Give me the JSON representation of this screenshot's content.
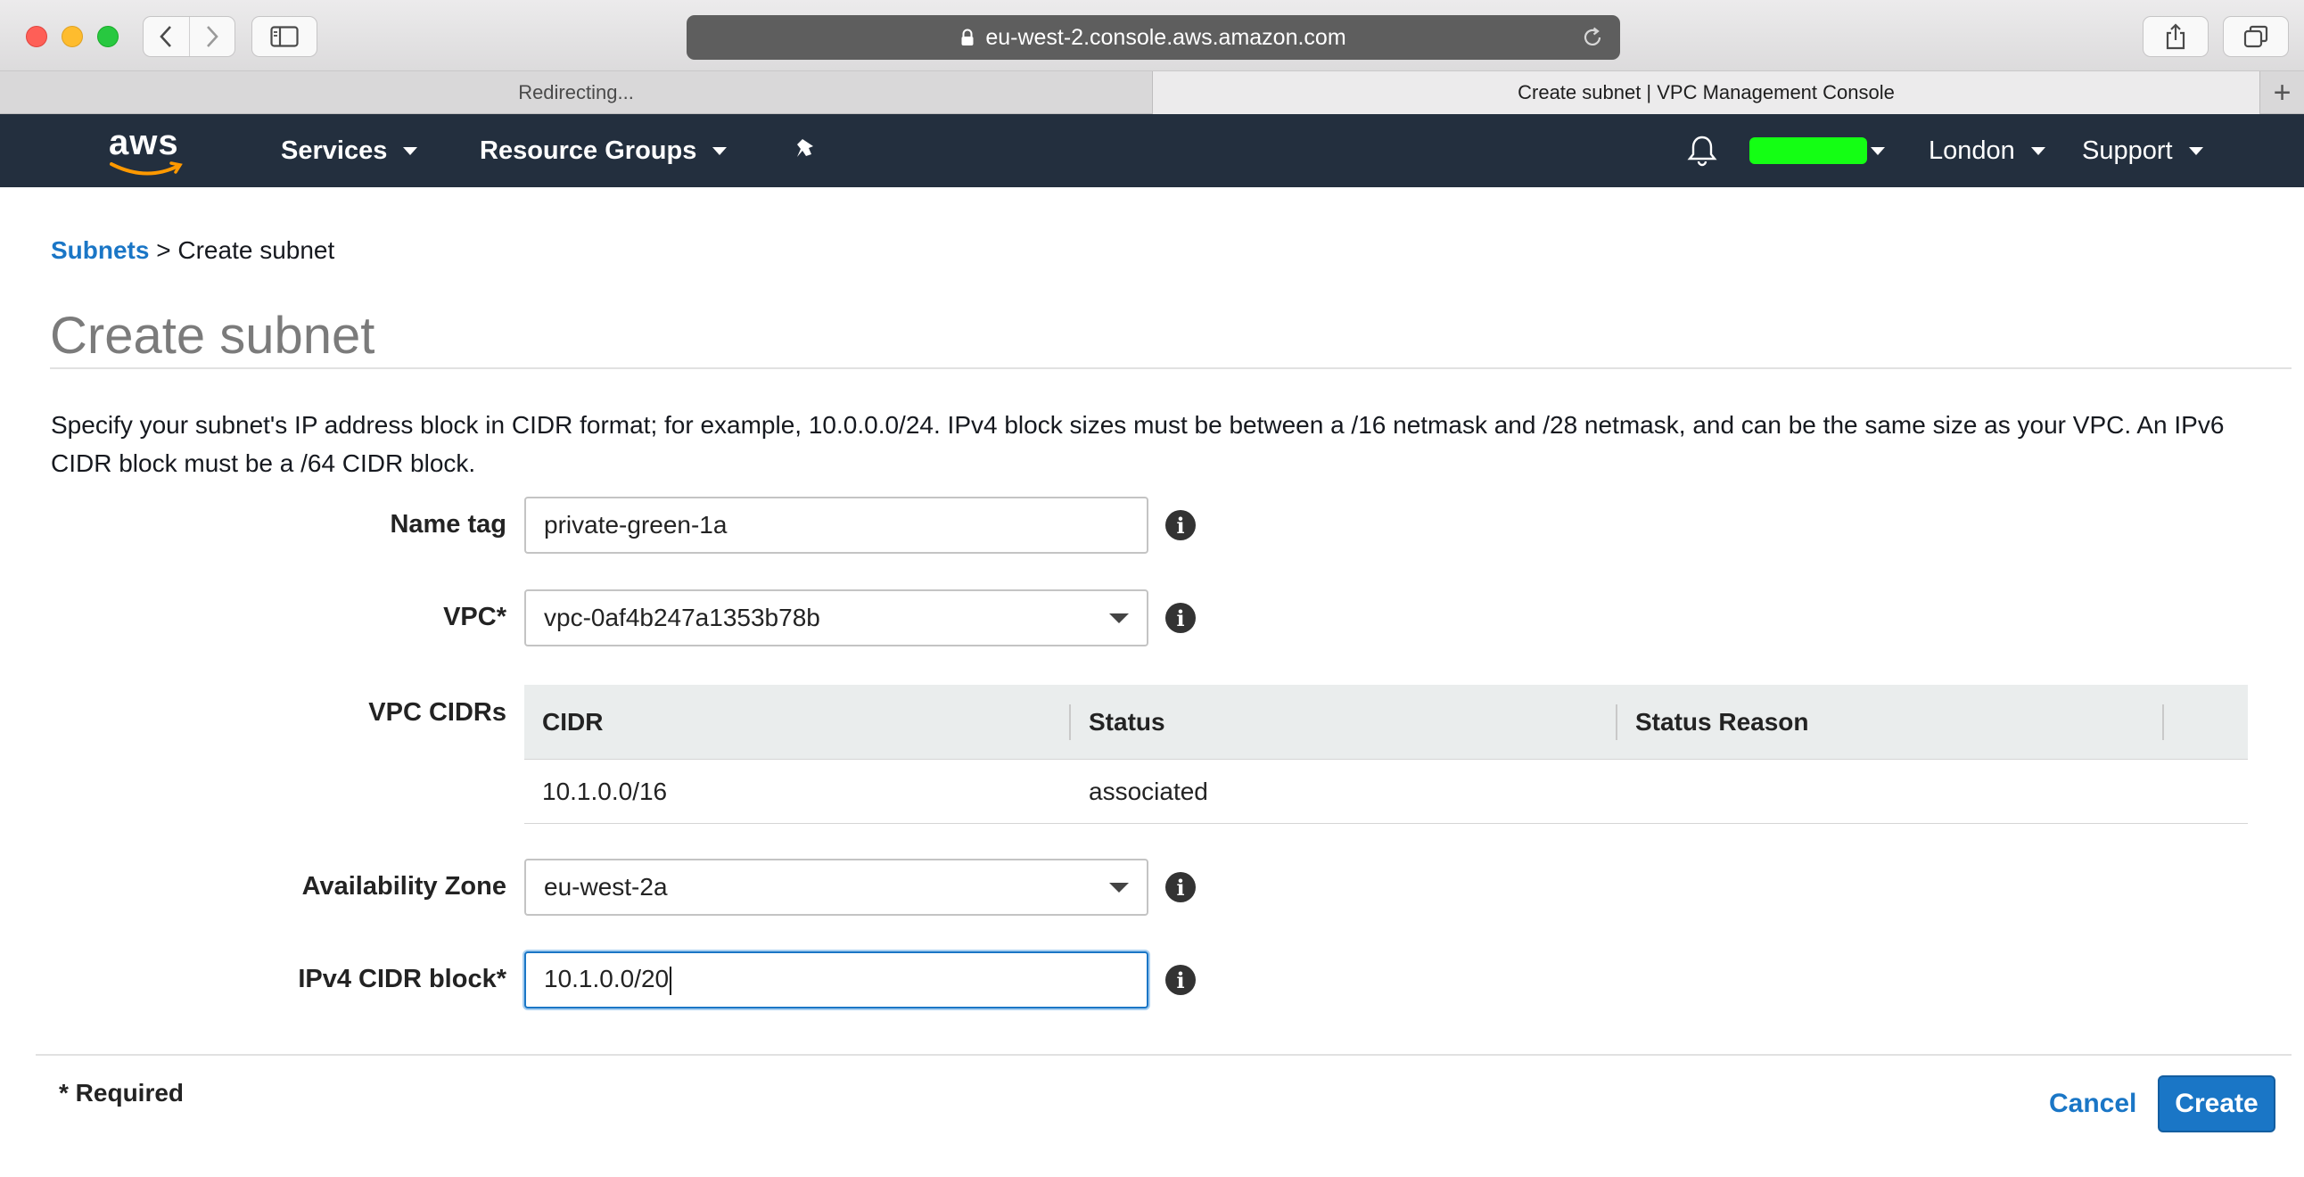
{
  "browser": {
    "url": "eu-west-2.console.aws.amazon.com",
    "tabs": [
      {
        "label": "Redirecting..."
      },
      {
        "label": "Create subnet | VPC Management Console"
      }
    ],
    "new_tab_label": "+"
  },
  "navbar": {
    "logo_text": "aws",
    "services": "Services",
    "resource_groups": "Resource Groups",
    "region": "London",
    "support": "Support",
    "account_color": "#14ff14",
    "icons": [
      "pin-icon",
      "bell-icon"
    ]
  },
  "breadcrumb": {
    "link": "Subnets",
    "separator": ">",
    "current": "Create subnet"
  },
  "page": {
    "title": "Create subnet",
    "description": "Specify your subnet's IP address block in CIDR format; for example, 10.0.0.0/24. IPv4 block sizes must be between a /16 netmask and /28 netmask, and can be the same size as your VPC. An IPv6 CIDR block must be a /64 CIDR block."
  },
  "form": {
    "name_tag": {
      "label": "Name tag",
      "value": "private-green-1a"
    },
    "vpc": {
      "label": "VPC*",
      "value": "vpc-0af4b247a1353b78b"
    },
    "vpc_cidrs": {
      "label": "VPC CIDRs",
      "columns": [
        "CIDR",
        "Status",
        "Status Reason"
      ],
      "rows": [
        {
          "cidr": "10.1.0.0/16",
          "status": "associated",
          "reason": ""
        }
      ]
    },
    "availability_zone": {
      "label": "Availability Zone",
      "value": "eu-west-2a"
    },
    "ipv4_cidr": {
      "label": "IPv4 CIDR block*",
      "value": "10.1.0.0/20"
    },
    "info_glyph": "i"
  },
  "footer": {
    "required_note": "* Required",
    "cancel": "Cancel",
    "create": "Create"
  },
  "colors": {
    "accent": "#1a76c6",
    "nav_bg": "#232f3e",
    "status_ok": "#1d8102"
  }
}
